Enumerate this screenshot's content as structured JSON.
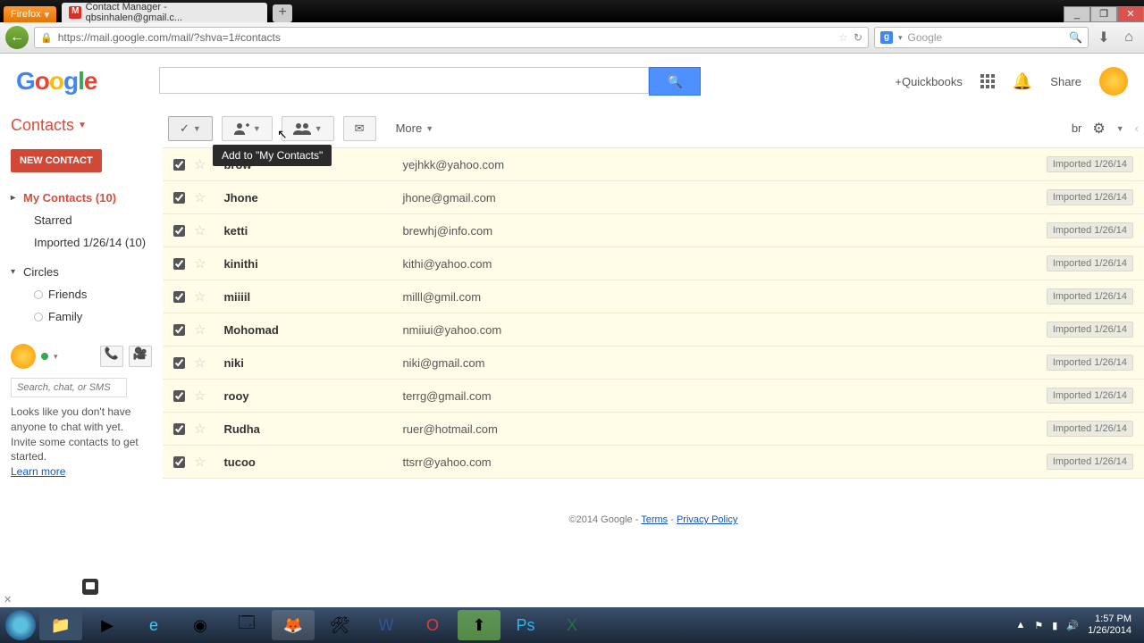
{
  "browser": {
    "menu_btn": "Firefox",
    "tab_title": "Contact Manager - qbsinhalen@gmail.c...",
    "url": "https://mail.google.com/mail/?shva=1#contacts",
    "search_engine": "Google",
    "search_placeholder": "Google"
  },
  "gbar": {
    "plus_link": "+Quickbooks",
    "share": "Share"
  },
  "sidebar": {
    "header": "Contacts",
    "new_contact": "NEW CONTACT",
    "my_contacts": "My Contacts (10)",
    "starred": "Starred",
    "imported": "Imported 1/26/14 (10)",
    "circles": "Circles",
    "friends": "Friends",
    "family": "Family",
    "chat_placeholder": "Search, chat, or SMS",
    "chat_msg": "Looks like you don't have anyone to chat with yet. Invite some contacts to get started.",
    "learn_more": "Learn more"
  },
  "toolbar": {
    "more": "More",
    "tooltip": "Add to \"My Contacts\"",
    "br": "br"
  },
  "contacts": [
    {
      "name": "brow",
      "email": "yejhkk@yahoo.com",
      "badge": "Imported 1/26/14"
    },
    {
      "name": "Jhone",
      "email": "jhone@gmail.com",
      "badge": "Imported 1/26/14"
    },
    {
      "name": "ketti",
      "email": "brewhj@info.com",
      "badge": "Imported 1/26/14"
    },
    {
      "name": "kinithi",
      "email": "kithi@yahoo.com",
      "badge": "Imported 1/26/14"
    },
    {
      "name": "miiiil",
      "email": "milll@gmil.com",
      "badge": "Imported 1/26/14"
    },
    {
      "name": "Mohomad",
      "email": "nmiiui@yahoo.com",
      "badge": "Imported 1/26/14"
    },
    {
      "name": "niki",
      "email": "niki@gmail.com",
      "badge": "Imported 1/26/14"
    },
    {
      "name": "rooy",
      "email": "terrg@gmail.com",
      "badge": "Imported 1/26/14"
    },
    {
      "name": "Rudha",
      "email": "ruer@hotmail.com",
      "badge": "Imported 1/26/14"
    },
    {
      "name": "tucoo",
      "email": "ttsrr@yahoo.com",
      "badge": "Imported 1/26/14"
    }
  ],
  "footer": {
    "copyright": "©2014 Google - ",
    "terms": "Terms",
    "sep": " - ",
    "privacy": "Privacy Policy"
  },
  "taskbar": {
    "time": "1:57 PM",
    "date": "1/26/2014"
  }
}
